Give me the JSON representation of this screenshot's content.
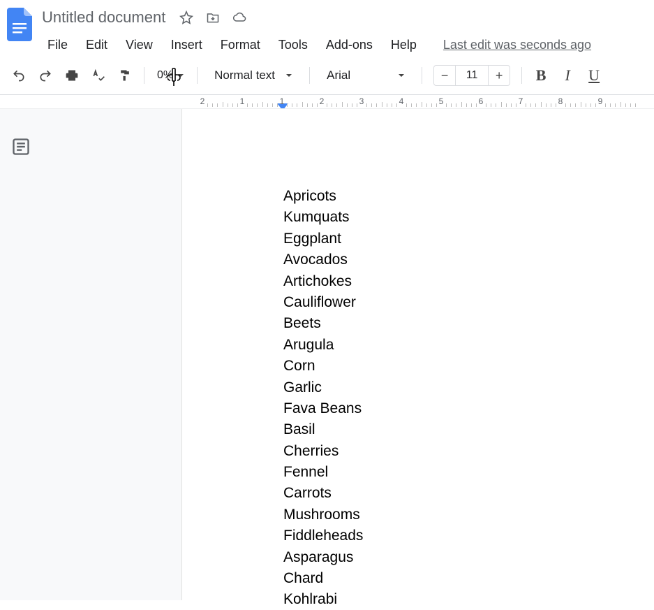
{
  "doc": {
    "title": "Untitled document",
    "last_edit": "Last edit was seconds ago"
  },
  "menus": {
    "file": "File",
    "edit": "Edit",
    "view": "View",
    "insert": "Insert",
    "format": "Format",
    "tools": "Tools",
    "addons": "Add-ons",
    "help": "Help"
  },
  "toolbar": {
    "zoom": "0%",
    "style": "Normal text",
    "font": "Arial",
    "font_size": "11"
  },
  "ruler": {
    "labels": [
      "2",
      "1",
      "1",
      "2",
      "3",
      "4",
      "5",
      "6",
      "7",
      "8",
      "9"
    ]
  },
  "content": {
    "lines": [
      "Apricots",
      "Kumquats",
      "Eggplant",
      "Avocados",
      "Artichokes",
      "Cauliflower",
      "Beets",
      "Arugula",
      "Corn",
      "Garlic",
      "Fava Beans",
      "Basil",
      "Cherries",
      "Fennel",
      "Carrots",
      "Mushrooms",
      "Fiddleheads",
      "Asparagus",
      "Chard",
      "Kohlrabi"
    ]
  }
}
